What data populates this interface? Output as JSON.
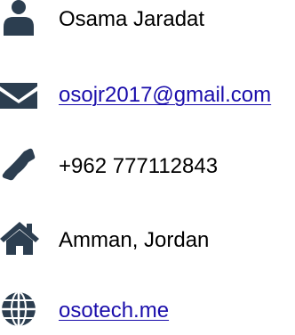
{
  "contact": {
    "name": "Osama Jaradat",
    "email": "osojr2017@gmail.com",
    "phone": "+962 777112843",
    "location": "Amman, Jordan",
    "website": "osotech.me"
  },
  "icons": {
    "name": "user-icon",
    "email": "envelope-icon",
    "phone": "phone-icon",
    "location": "home-icon",
    "website": "globe-icon"
  },
  "colors": {
    "icon": "#2c3e50",
    "link": "#1a0dab",
    "text": "#000000"
  }
}
